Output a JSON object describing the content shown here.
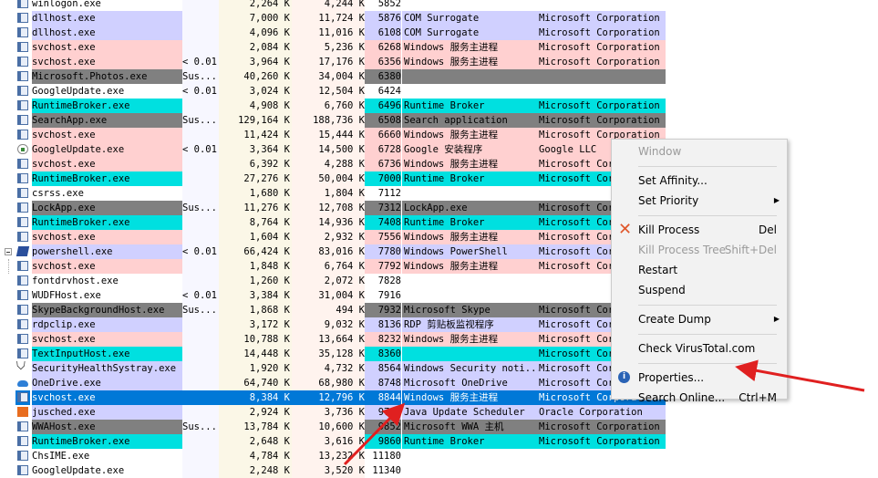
{
  "colors": {
    "cpu_col_bg": "#f7f7ff",
    "priv_col_bg": "#fbf7e7",
    "ws_col_bg": "#fff3ee",
    "row_service": "#ffd0d0",
    "row_own": "#d0d0ff",
    "row_suspended": "#808080",
    "row_immersive": "#00e0e0",
    "row_selected": "#0078d7",
    "arrow": "#e02020",
    "kill_icon": "#e0572b"
  },
  "rows": [
    {
      "name": "winlogon.exe",
      "cpu": "",
      "priv": "2,264 K",
      "ws": "4,244 K",
      "pid": "5852",
      "desc": "",
      "company": "",
      "kind": "plain",
      "icon": "app"
    },
    {
      "name": "dllhost.exe",
      "cpu": "",
      "priv": "7,000 K",
      "ws": "11,724 K",
      "pid": "5876",
      "desc": "COM Surrogate",
      "company": "Microsoft Corporation",
      "kind": "own",
      "icon": "app"
    },
    {
      "name": "dllhost.exe",
      "cpu": "",
      "priv": "4,096 K",
      "ws": "11,016 K",
      "pid": "6108",
      "desc": "COM Surrogate",
      "company": "Microsoft Corporation",
      "kind": "own",
      "icon": "app"
    },
    {
      "name": "svchost.exe",
      "cpu": "",
      "priv": "2,084 K",
      "ws": "5,236 K",
      "pid": "6268",
      "desc": "Windows 服务主进程",
      "company": "Microsoft Corporation",
      "kind": "service",
      "icon": "app"
    },
    {
      "name": "svchost.exe",
      "cpu": "< 0.01",
      "priv": "3,964 K",
      "ws": "17,176 K",
      "pid": "6356",
      "desc": "Windows 服务主进程",
      "company": "Microsoft Corporation",
      "kind": "service",
      "icon": "app"
    },
    {
      "name": "Microsoft.Photos.exe",
      "cpu": "Sus...",
      "priv": "40,260 K",
      "ws": "34,004 K",
      "pid": "6380",
      "desc": "",
      "company": "",
      "kind": "suspended",
      "icon": "app"
    },
    {
      "name": "GoogleUpdate.exe",
      "cpu": "< 0.01",
      "priv": "3,024 K",
      "ws": "12,504 K",
      "pid": "6424",
      "desc": "",
      "company": "",
      "kind": "plain",
      "icon": "app"
    },
    {
      "name": "RuntimeBroker.exe",
      "cpu": "",
      "priv": "4,908 K",
      "ws": "6,760 K",
      "pid": "6496",
      "desc": "Runtime Broker",
      "company": "Microsoft Corporation",
      "kind": "immersive",
      "icon": "app"
    },
    {
      "name": "SearchApp.exe",
      "cpu": "Sus...",
      "priv": "129,164 K",
      "ws": "188,736 K",
      "pid": "6508",
      "desc": "Search application",
      "company": "Microsoft Corporation",
      "kind": "suspended",
      "icon": "app"
    },
    {
      "name": "svchost.exe",
      "cpu": "",
      "priv": "11,424 K",
      "ws": "15,444 K",
      "pid": "6660",
      "desc": "Windows 服务主进程",
      "company": "Microsoft Corporation",
      "kind": "service",
      "icon": "app"
    },
    {
      "name": "GoogleUpdate.exe",
      "cpu": "< 0.01",
      "priv": "3,364 K",
      "ws": "14,500 K",
      "pid": "6728",
      "desc": "Google 安装程序",
      "company": "Google LLC",
      "kind": "service",
      "icon": "google"
    },
    {
      "name": "svchost.exe",
      "cpu": "",
      "priv": "6,392 K",
      "ws": "4,288 K",
      "pid": "6736",
      "desc": "Windows 服务主进程",
      "company": "Microsoft Corporation",
      "kind": "service",
      "icon": "app"
    },
    {
      "name": "RuntimeBroker.exe",
      "cpu": "",
      "priv": "27,276 K",
      "ws": "50,004 K",
      "pid": "7000",
      "desc": "Runtime Broker",
      "company": "Microsoft Corporation",
      "kind": "immersive",
      "icon": "app"
    },
    {
      "name": "csrss.exe",
      "cpu": "",
      "priv": "1,680 K",
      "ws": "1,804 K",
      "pid": "7112",
      "desc": "",
      "company": "",
      "kind": "plain",
      "icon": "app"
    },
    {
      "name": "LockApp.exe",
      "cpu": "Sus...",
      "priv": "11,276 K",
      "ws": "12,708 K",
      "pid": "7312",
      "desc": "LockApp.exe",
      "company": "Microsoft Corporation",
      "kind": "suspended",
      "icon": "app"
    },
    {
      "name": "RuntimeBroker.exe",
      "cpu": "",
      "priv": "8,764 K",
      "ws": "14,936 K",
      "pid": "7408",
      "desc": "Runtime Broker",
      "company": "Microsoft Corporation",
      "kind": "immersive",
      "icon": "app"
    },
    {
      "name": "svchost.exe",
      "cpu": "",
      "priv": "1,604 K",
      "ws": "2,932 K",
      "pid": "7556",
      "desc": "Windows 服务主进程",
      "company": "Microsoft Corporation",
      "kind": "service",
      "icon": "app"
    },
    {
      "name": "powershell.exe",
      "cpu": "< 0.01",
      "priv": "66,424 K",
      "ws": "83,016 K",
      "pid": "7780",
      "desc": "Windows PowerShell",
      "company": "Microsoft Corporation",
      "kind": "own",
      "icon": "ps",
      "tree": "collapse"
    },
    {
      "name": "svchost.exe",
      "cpu": "",
      "priv": "1,848 K",
      "ws": "6,764 K",
      "pid": "7792",
      "desc": "Windows 服务主进程",
      "company": "Microsoft Corporation",
      "kind": "service",
      "icon": "app",
      "tree": "line"
    },
    {
      "name": "fontdrvhost.exe",
      "cpu": "",
      "priv": "1,260 K",
      "ws": "2,072 K",
      "pid": "7828",
      "desc": "",
      "company": "",
      "kind": "plain",
      "icon": "app"
    },
    {
      "name": "WUDFHost.exe",
      "cpu": "< 0.01",
      "priv": "3,384 K",
      "ws": "31,004 K",
      "pid": "7916",
      "desc": "",
      "company": "",
      "kind": "plain",
      "icon": "app"
    },
    {
      "name": "SkypeBackgroundHost.exe",
      "cpu": "Sus...",
      "priv": "1,868 K",
      "ws": "494 K",
      "pid": "7932",
      "desc": "Microsoft Skype",
      "company": "Microsoft Corporation",
      "kind": "suspended",
      "icon": "app"
    },
    {
      "name": "rdpclip.exe",
      "cpu": "",
      "priv": "3,172 K",
      "ws": "9,032 K",
      "pid": "8136",
      "desc": "RDP 剪贴板监视程序",
      "company": "Microsoft Corporation",
      "kind": "own",
      "icon": "app"
    },
    {
      "name": "svchost.exe",
      "cpu": "",
      "priv": "10,788 K",
      "ws": "13,664 K",
      "pid": "8232",
      "desc": "Windows 服务主进程",
      "company": "Microsoft Corporation",
      "kind": "service",
      "icon": "app"
    },
    {
      "name": "TextInputHost.exe",
      "cpu": "",
      "priv": "14,448 K",
      "ws": "35,128 K",
      "pid": "8360",
      "desc": "",
      "company": "Microsoft Corporation",
      "kind": "immersive",
      "icon": "app"
    },
    {
      "name": "SecurityHealthSystray.exe",
      "cpu": "",
      "priv": "1,920 K",
      "ws": "4,732 K",
      "pid": "8564",
      "desc": "Windows Security noti...",
      "company": "Microsoft Corporation",
      "kind": "own",
      "icon": "shield"
    },
    {
      "name": "OneDrive.exe",
      "cpu": "",
      "priv": "64,740 K",
      "ws": "68,980 K",
      "pid": "8748",
      "desc": "Microsoft OneDrive",
      "company": "Microsoft Corporation",
      "kind": "own",
      "icon": "cloud"
    },
    {
      "name": "svchost.exe",
      "cpu": "",
      "priv": "8,384 K",
      "ws": "12,796 K",
      "pid": "8844",
      "desc": "Windows 服务主进程",
      "company": "Microsoft Corporation",
      "kind": "selected",
      "icon": "app"
    },
    {
      "name": "jusched.exe",
      "cpu": "",
      "priv": "2,924 K",
      "ws": "3,736 K",
      "pid": "9740",
      "desc": "Java Update Scheduler",
      "company": "Oracle Corporation",
      "kind": "own",
      "icon": "java"
    },
    {
      "name": "WWAHost.exe",
      "cpu": "Sus...",
      "priv": "13,784 K",
      "ws": "10,600 K",
      "pid": "9852",
      "desc": "Microsoft WWA 主机",
      "company": "Microsoft Corporation",
      "kind": "suspended",
      "icon": "app"
    },
    {
      "name": "RuntimeBroker.exe",
      "cpu": "",
      "priv": "2,648 K",
      "ws": "3,616 K",
      "pid": "9860",
      "desc": "Runtime Broker",
      "company": "Microsoft Corporation",
      "kind": "immersive",
      "icon": "app"
    },
    {
      "name": "ChsIME.exe",
      "cpu": "",
      "priv": "4,784 K",
      "ws": "13,232 K",
      "pid": "11180",
      "desc": "",
      "company": "",
      "kind": "plain",
      "icon": "app"
    },
    {
      "name": "GoogleUpdate.exe",
      "cpu": "",
      "priv": "2,248 K",
      "ws": "3,520 K",
      "pid": "11340",
      "desc": "",
      "company": "",
      "kind": "plain",
      "icon": "app"
    }
  ],
  "context_menu": {
    "items": [
      {
        "label": "Window",
        "disabled": true,
        "name": "menu-item-window",
        "u": "W"
      },
      {
        "sep": true
      },
      {
        "label": "Set Affinity...",
        "name": "menu-item-set-affinity",
        "u": "A"
      },
      {
        "label": "Set Priority",
        "name": "menu-item-set-priority",
        "submenu": true,
        "u": "S"
      },
      {
        "sep": true
      },
      {
        "label": "Kill Process",
        "shortcut": "Del",
        "name": "menu-item-kill-process",
        "icon": "kill",
        "u": "K"
      },
      {
        "label": "Kill Process Tree",
        "shortcut": "Shift+Del",
        "disabled": true,
        "name": "menu-item-kill-process-tree"
      },
      {
        "label": "Restart",
        "name": "menu-item-restart",
        "u": "R"
      },
      {
        "label": "Suspend",
        "name": "menu-item-suspend",
        "u": "S"
      },
      {
        "sep": true
      },
      {
        "label": "Create Dump",
        "name": "menu-item-create-dump",
        "submenu": true,
        "u": "C"
      },
      {
        "sep": true
      },
      {
        "label": "Check VirusTotal.com",
        "name": "menu-item-check-virustotal",
        "u": "V"
      },
      {
        "sep": true
      },
      {
        "label": "Properties...",
        "name": "menu-item-properties",
        "icon": "props",
        "u": "P"
      },
      {
        "label": "Search Online...",
        "shortcut": "Ctrl+M",
        "name": "menu-item-search-online",
        "u": "O"
      }
    ],
    "submenu_glyph": "▶",
    "kill_glyph": "✕",
    "props_glyph": "i"
  }
}
